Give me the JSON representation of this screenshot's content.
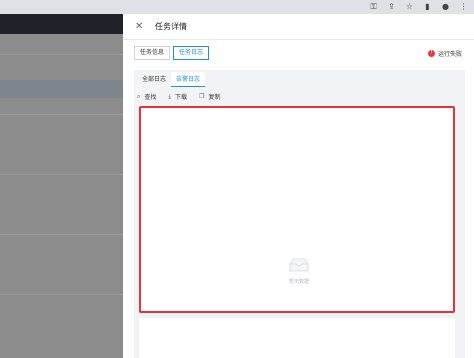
{
  "browser": {
    "icons": [
      "key-icon",
      "share-icon",
      "star-icon",
      "sidepanel-icon",
      "profile-icon",
      "menu-icon"
    ],
    "glyphs": [
      "⚿",
      "⇪",
      "☆",
      "▮",
      "●",
      "⋮"
    ]
  },
  "drawer": {
    "title": "任务详情",
    "close_glyph": "✕",
    "tabs": [
      {
        "label": "任务信息"
      },
      {
        "label": "任务日志"
      }
    ],
    "status": {
      "text": "运行失败",
      "color": "#e8363f",
      "glyph": "!"
    }
  },
  "log": {
    "tabs": [
      {
        "label": "全部日志"
      },
      {
        "label": "告警日志"
      }
    ],
    "toolbar": [
      {
        "label": "查找",
        "glyph": "⌕"
      },
      {
        "label": "下载",
        "glyph": "⤓"
      },
      {
        "label": "复制",
        "glyph": "❐"
      }
    ],
    "empty_text": "暂无数据",
    "panel_border_color": "#e4353f"
  }
}
